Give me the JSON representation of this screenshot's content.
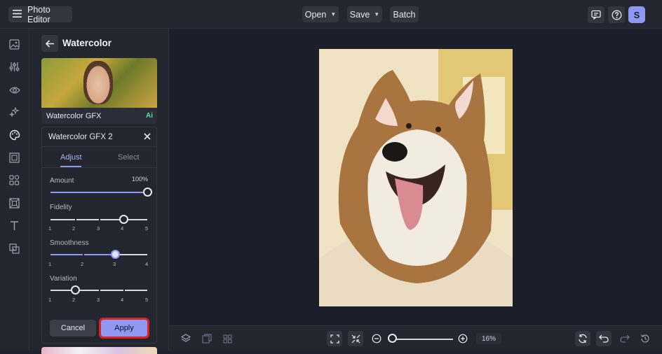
{
  "app": {
    "title": "Photo Editor"
  },
  "toolbar": {
    "open_label": "Open",
    "save_label": "Save",
    "batch_label": "Batch",
    "user_initial": "S"
  },
  "rail": {
    "icons": [
      "image-icon",
      "sliders-icon",
      "eye-icon",
      "magic-icon",
      "palette-icon",
      "frame-icon",
      "shapes-icon",
      "texture-icon",
      "text-icon",
      "layers-overlay-icon"
    ]
  },
  "panel": {
    "title": "Watercolor",
    "preset_thumbnail_label": "Watercolor GFX",
    "ai_badge": "Ai",
    "settings_title": "Watercolor GFX 2",
    "tabs": [
      {
        "label": "Adjust",
        "active": true
      },
      {
        "label": "Select",
        "active": false
      }
    ],
    "sliders": [
      {
        "label": "Amount",
        "value_text": "100%",
        "value": 100,
        "min": 0,
        "max": 100
      },
      {
        "label": "Fidelity",
        "value": 4,
        "ticks": [
          "1",
          "2",
          "3",
          "4",
          "5"
        ]
      },
      {
        "label": "Smoothness",
        "value": 3,
        "ticks": [
          "1",
          "2",
          "3",
          "4"
        ]
      },
      {
        "label": "Variation",
        "value": 2,
        "ticks": [
          "1",
          "2",
          "3",
          "4",
          "5"
        ]
      }
    ],
    "cancel_label": "Cancel",
    "apply_label": "Apply"
  },
  "canvas": {
    "image_description_icon": "dog-photo"
  },
  "bottom": {
    "zoom_text": "16%",
    "zoom_value": 16
  },
  "colors": {
    "accent": "#8f99f3",
    "highlight_outline": "#e02020",
    "background": "#1f2230"
  }
}
